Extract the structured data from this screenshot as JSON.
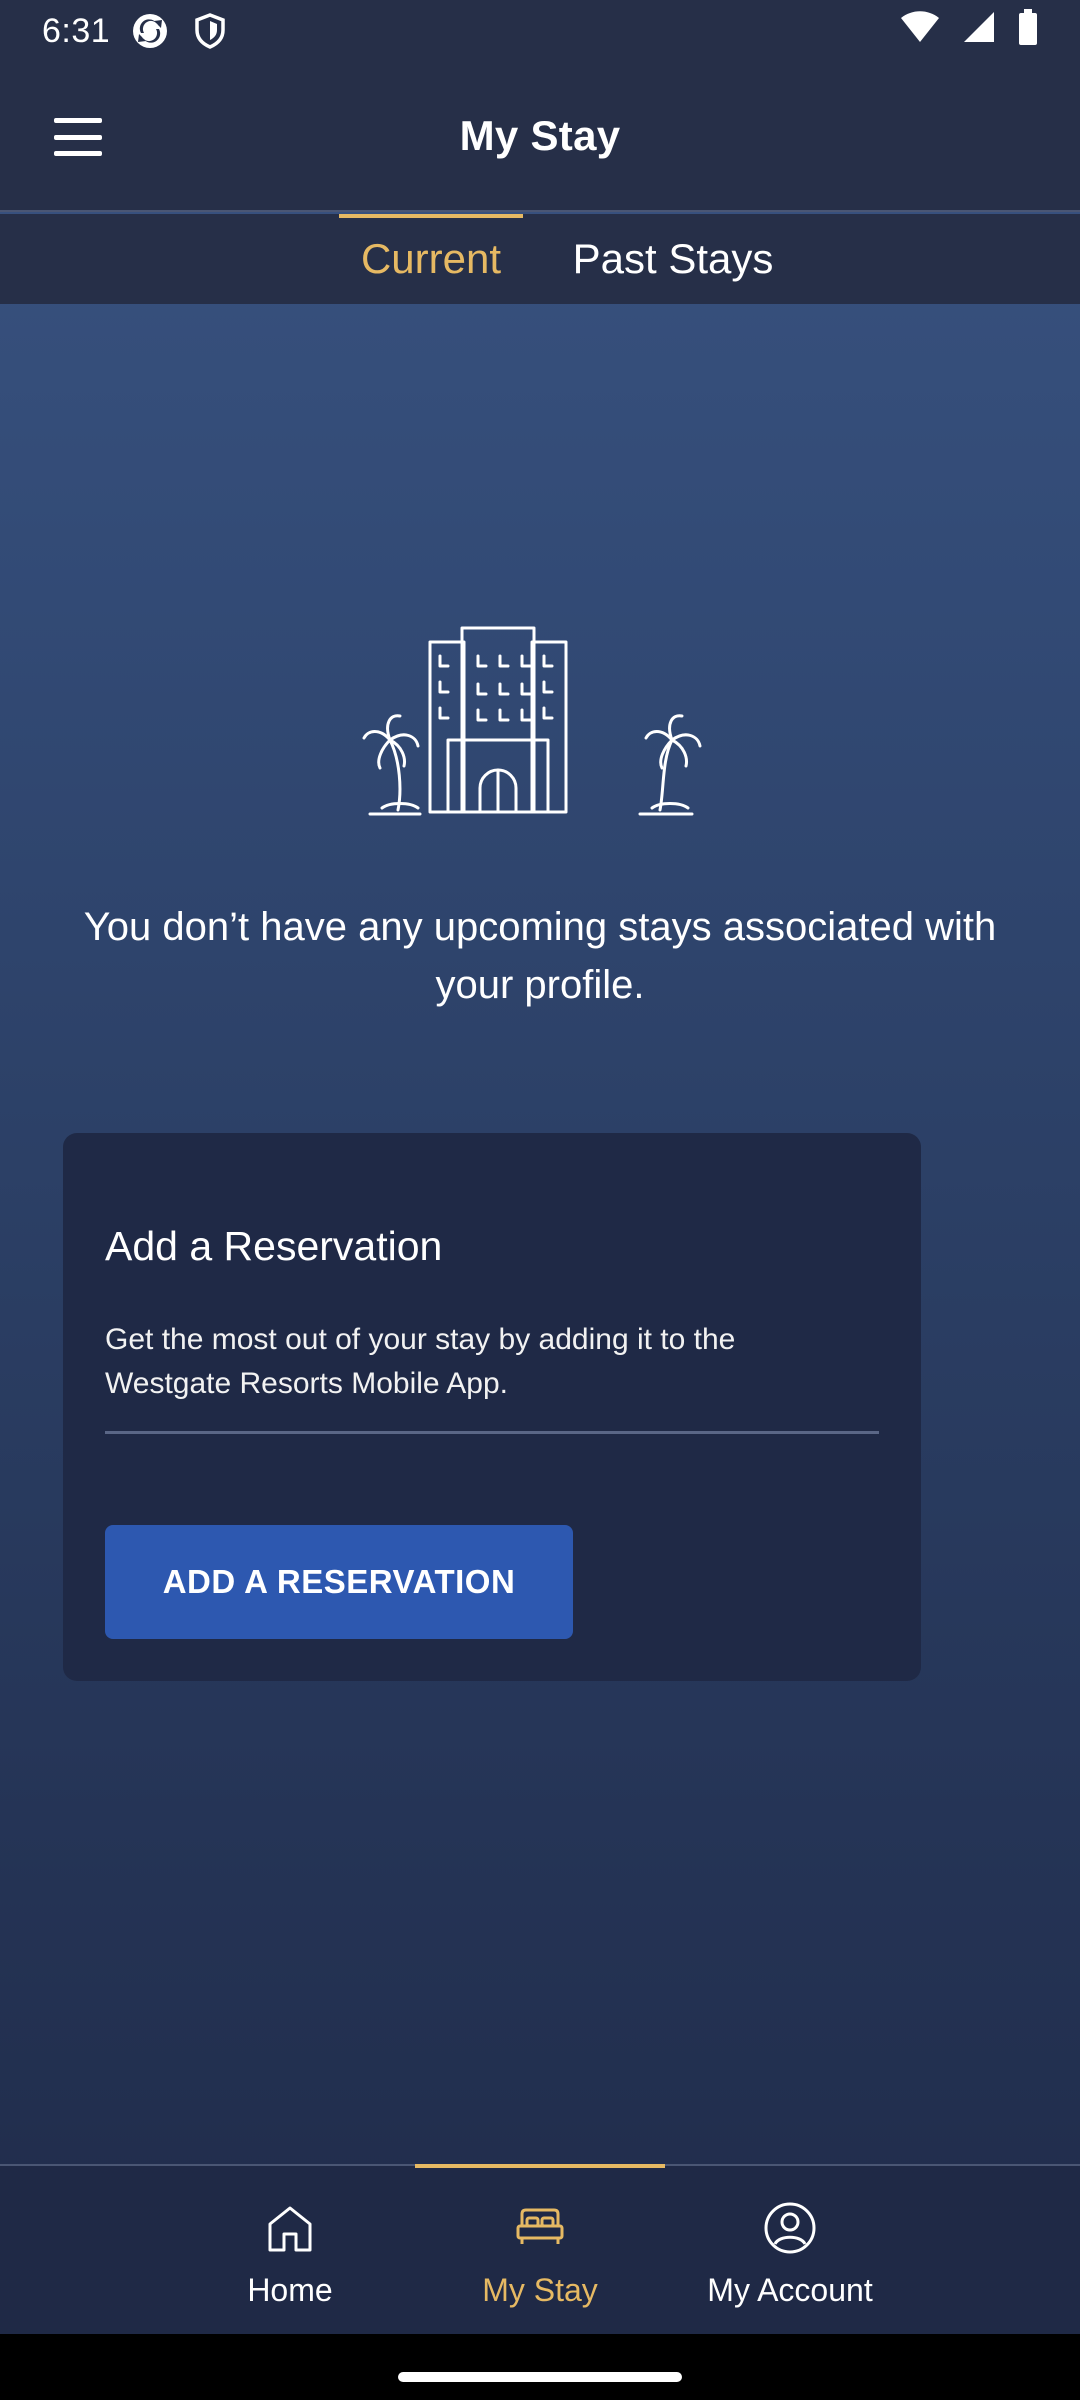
{
  "status_bar": {
    "time": "6:31",
    "left_icons": [
      "sync-icon",
      "shield-icon"
    ],
    "right_icons": [
      "wifi-icon",
      "signal-icon",
      "battery-icon"
    ]
  },
  "header": {
    "title": "My Stay",
    "menu_icon": "hamburger-menu-icon"
  },
  "tabs": {
    "items": [
      {
        "label": "Current",
        "active": true
      },
      {
        "label": "Past Stays",
        "active": false
      }
    ],
    "accent_color": "#e6b963"
  },
  "empty_state": {
    "icon": "hotel-palm-trees-icon",
    "message": "You don’t have any upcoming stays associated with your profile."
  },
  "reservation_card": {
    "title": "Add a Reservation",
    "description": "Get the most out of your stay by adding it to the Westgate Resorts Mobile App.",
    "button_label": "ADD A RESERVATION",
    "button_color": "#2d58b0"
  },
  "bottom_nav": {
    "items": [
      {
        "label": "Home",
        "icon": "home-icon",
        "active": false
      },
      {
        "label": "My Stay",
        "icon": "bed-icon",
        "active": true
      },
      {
        "label": "My Account",
        "icon": "account-icon",
        "active": false
      }
    ]
  },
  "colors": {
    "bar_background": "#262f48",
    "card_background": "#1f2946",
    "accent": "#e6b963"
  }
}
